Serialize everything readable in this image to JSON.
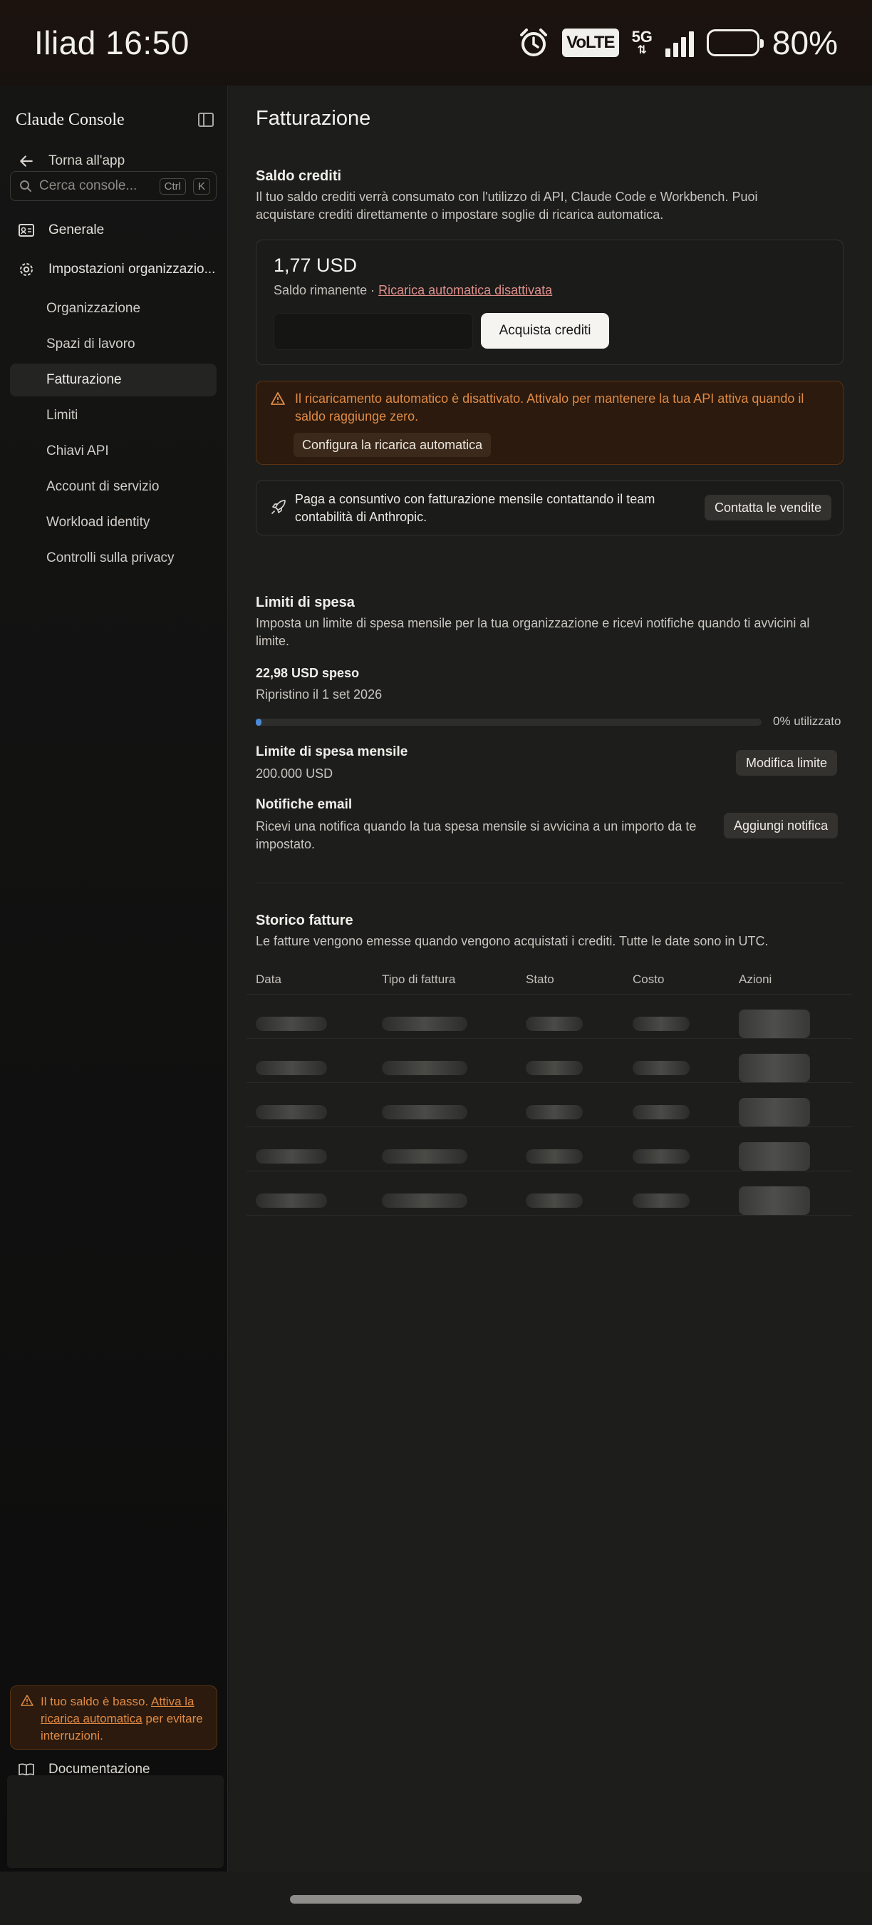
{
  "status_bar": {
    "carrier": "Iliad",
    "time": "16:50",
    "volte": "VoLTE",
    "network": "5G",
    "battery": "80%",
    "battery_level": 0.8
  },
  "sidebar": {
    "brand": "Claude Console",
    "back_label": "Torna all'app",
    "search": {
      "placeholder": "Cerca console...",
      "kbd1": "Ctrl",
      "kbd2": "K"
    },
    "general": "Generale",
    "org_settings": "Impostazioni organizzazio...",
    "sub_items": [
      {
        "label": "Organizzazione"
      },
      {
        "label": "Spazi di lavoro"
      },
      {
        "label": "Fatturazione"
      },
      {
        "label": "Limiti"
      },
      {
        "label": "Chiavi API"
      },
      {
        "label": "Account di servizio"
      },
      {
        "label": "Workload identity"
      },
      {
        "label": "Controlli sulla privacy"
      }
    ],
    "active_item": "Fatturazione",
    "low_balance": {
      "text1": "Il tuo saldo è basso.",
      "link": "Attiva la ricarica automatica",
      "text2": "per evitare interruzioni."
    },
    "docs": "Documentazione"
  },
  "main": {
    "title": "Fatturazione",
    "credits": {
      "heading": "Saldo crediti",
      "description": "Il tuo saldo crediti verrà consumato con l'utilizzo di API, Claude Code e Workbench. Puoi acquistare crediti direttamente o impostare soglie di ricarica automatica.",
      "amount": "1,77 USD",
      "remaining": "Saldo rimanente · ",
      "auto_reload_link": "Ricarica automatica disattivata",
      "buy_button": "Acquista crediti"
    },
    "warning": {
      "text": "Il ricaricamento automatico è disattivato. Attivalo per mantenere la tua API attiva quando il saldo raggiunge zero.",
      "button": "Configura la ricarica automatica"
    },
    "invoice_pay": {
      "text": "Paga a consuntivo con fatturazione mensile contattando il team contabilità di Anthropic.",
      "button": "Contatta le vendite"
    },
    "spend_limits": {
      "heading": "Limiti di spesa",
      "description": "Imposta un limite di spesa mensile per la tua organizzazione e ricevi notifiche quando ti avvicini al limite.",
      "spent": "22,98 USD speso",
      "reset": "Ripristino il 1 set 2026",
      "usage_label": "0% utilizzato",
      "usage_fraction": 0.0001,
      "monthly_label": "Limite di spesa mensile",
      "monthly_value": "200.000 USD",
      "edit_button": "Modifica limite",
      "email_label": "Notifiche email",
      "email_desc": "Ricevi una notifica quando la tua spesa mensile si avvicina a un importo da te impostato.",
      "add_button": "Aggiungi notifica"
    },
    "invoices": {
      "heading": "Storico fatture",
      "description": "Le fatture vengono emesse quando vengono acquistati i crediti. Tutte le date sono in UTC.",
      "columns": [
        "Data",
        "Tipo di fattura",
        "Stato",
        "Costo",
        "Azioni"
      ]
    }
  }
}
